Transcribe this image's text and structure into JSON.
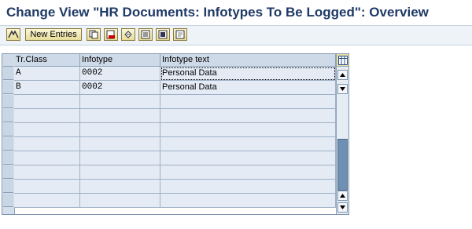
{
  "window": {
    "title": "Change View \"HR Documents: Infotypes To Be Logged\": Overview"
  },
  "toolbar": {
    "new_entries_label": "New Entries",
    "icons": [
      "display-change-icon",
      "copy-icon",
      "delete-icon",
      "undo-icon",
      "select-all-icon",
      "select-block-icon",
      "deselect-all-icon"
    ]
  },
  "table": {
    "columns": [
      "Tr.Class",
      "Infotype",
      "Infotype text"
    ],
    "rows": [
      {
        "tr_class": "A",
        "infotype": "0002",
        "infotype_text": "Personal Data"
      },
      {
        "tr_class": "B",
        "infotype": "0002",
        "infotype_text": "Personal Data"
      },
      {
        "tr_class": "",
        "infotype": "",
        "infotype_text": ""
      },
      {
        "tr_class": "",
        "infotype": "",
        "infotype_text": ""
      },
      {
        "tr_class": "",
        "infotype": "",
        "infotype_text": ""
      },
      {
        "tr_class": "",
        "infotype": "",
        "infotype_text": ""
      },
      {
        "tr_class": "",
        "infotype": "",
        "infotype_text": ""
      },
      {
        "tr_class": "",
        "infotype": "",
        "infotype_text": ""
      },
      {
        "tr_class": "",
        "infotype": "",
        "infotype_text": ""
      },
      {
        "tr_class": "",
        "infotype": "",
        "infotype_text": ""
      }
    ]
  },
  "colors": {
    "title": "#1f3a66",
    "cell_bg": "#e4ebf5",
    "header_bg": "#cfdae8",
    "toolbar_button": "#e8dc98"
  }
}
